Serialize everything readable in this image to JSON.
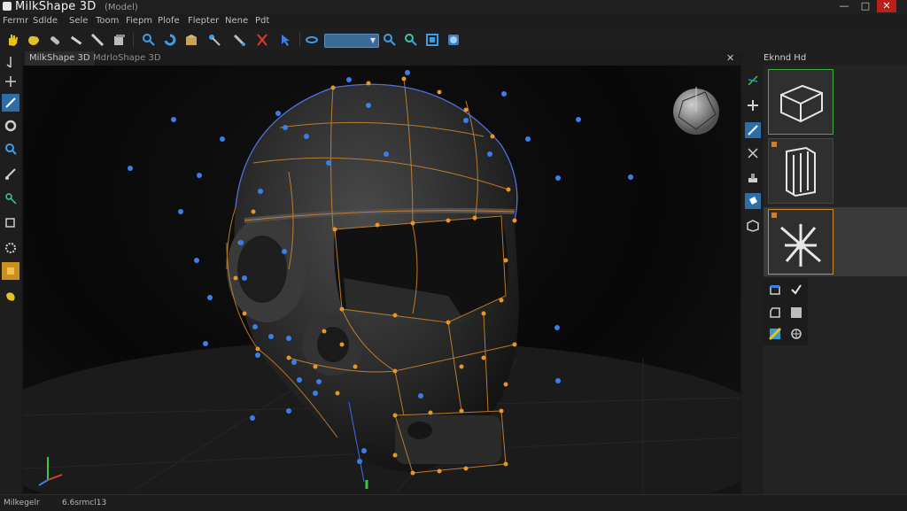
{
  "window": {
    "title": "MilkShape 3D",
    "subtitle": "(Model)",
    "min_glyph": "—",
    "max_glyph": "□",
    "close_glyph": "✕"
  },
  "menu": [
    {
      "label": "Fermr"
    },
    {
      "label": "Sdlde"
    },
    {
      "label": "Sele"
    },
    {
      "label": "Toom"
    },
    {
      "label": "Fiepm"
    },
    {
      "label": "Plofe"
    },
    {
      "label": "Flepter"
    },
    {
      "label": "Nene"
    },
    {
      "label": "Pdt"
    }
  ],
  "toolbar": {
    "icons": [
      "yellow-hand-icon",
      "grab-icon",
      "tool-icon",
      "pen-icon",
      "knife-icon",
      "box-icon",
      "magnify-icon",
      "rotate-icon",
      "package-icon",
      "dropper-icon",
      "pipette-icon",
      "scissors-icon",
      "cursor-icon",
      "orbit-icon",
      "zoom-icon",
      "zoom-fit-icon",
      "frame-icon",
      "globe-icon"
    ],
    "dropdown_value": ""
  },
  "left_tools": [
    "pointer-icon",
    "move-icon",
    "paint-icon",
    "lasso-icon",
    "search-icon",
    "brush-icon",
    "select-icon",
    "rect-select-icon",
    "gear-icon",
    "tag-icon",
    "hand-icon",
    "axis-icon"
  ],
  "viewport": {
    "tabs": [
      "MilkShape 3D",
      "MdrloShape 3D"
    ],
    "close_glyph": "✕"
  },
  "panel": {
    "title": "Eknnd Hd",
    "thumbnails": [
      "cube-thumbnail",
      "pages-thumbnail",
      "skeleton-thumbnail"
    ]
  },
  "right_tools": [
    "axis-gizmo-icon",
    "plus-icon",
    "edit-icon",
    "scale-icon",
    "stamp-icon",
    "paint-bucket-icon",
    "cube-icon"
  ],
  "mini_tools": [
    "layer-icon",
    "check-icon",
    "duplicate-icon",
    "block-icon",
    "texture-icon",
    "target-icon"
  ],
  "status": {
    "left": "Milkegelr",
    "right": "6.6srmcl13"
  },
  "colors": {
    "vertex_orange": "#e8952a",
    "vertex_blue": "#3a7ee8",
    "wire": "#c8842f",
    "mesh_dark": "#262626",
    "accent_green": "#3fae45",
    "accent_orange": "#d28a2c"
  }
}
